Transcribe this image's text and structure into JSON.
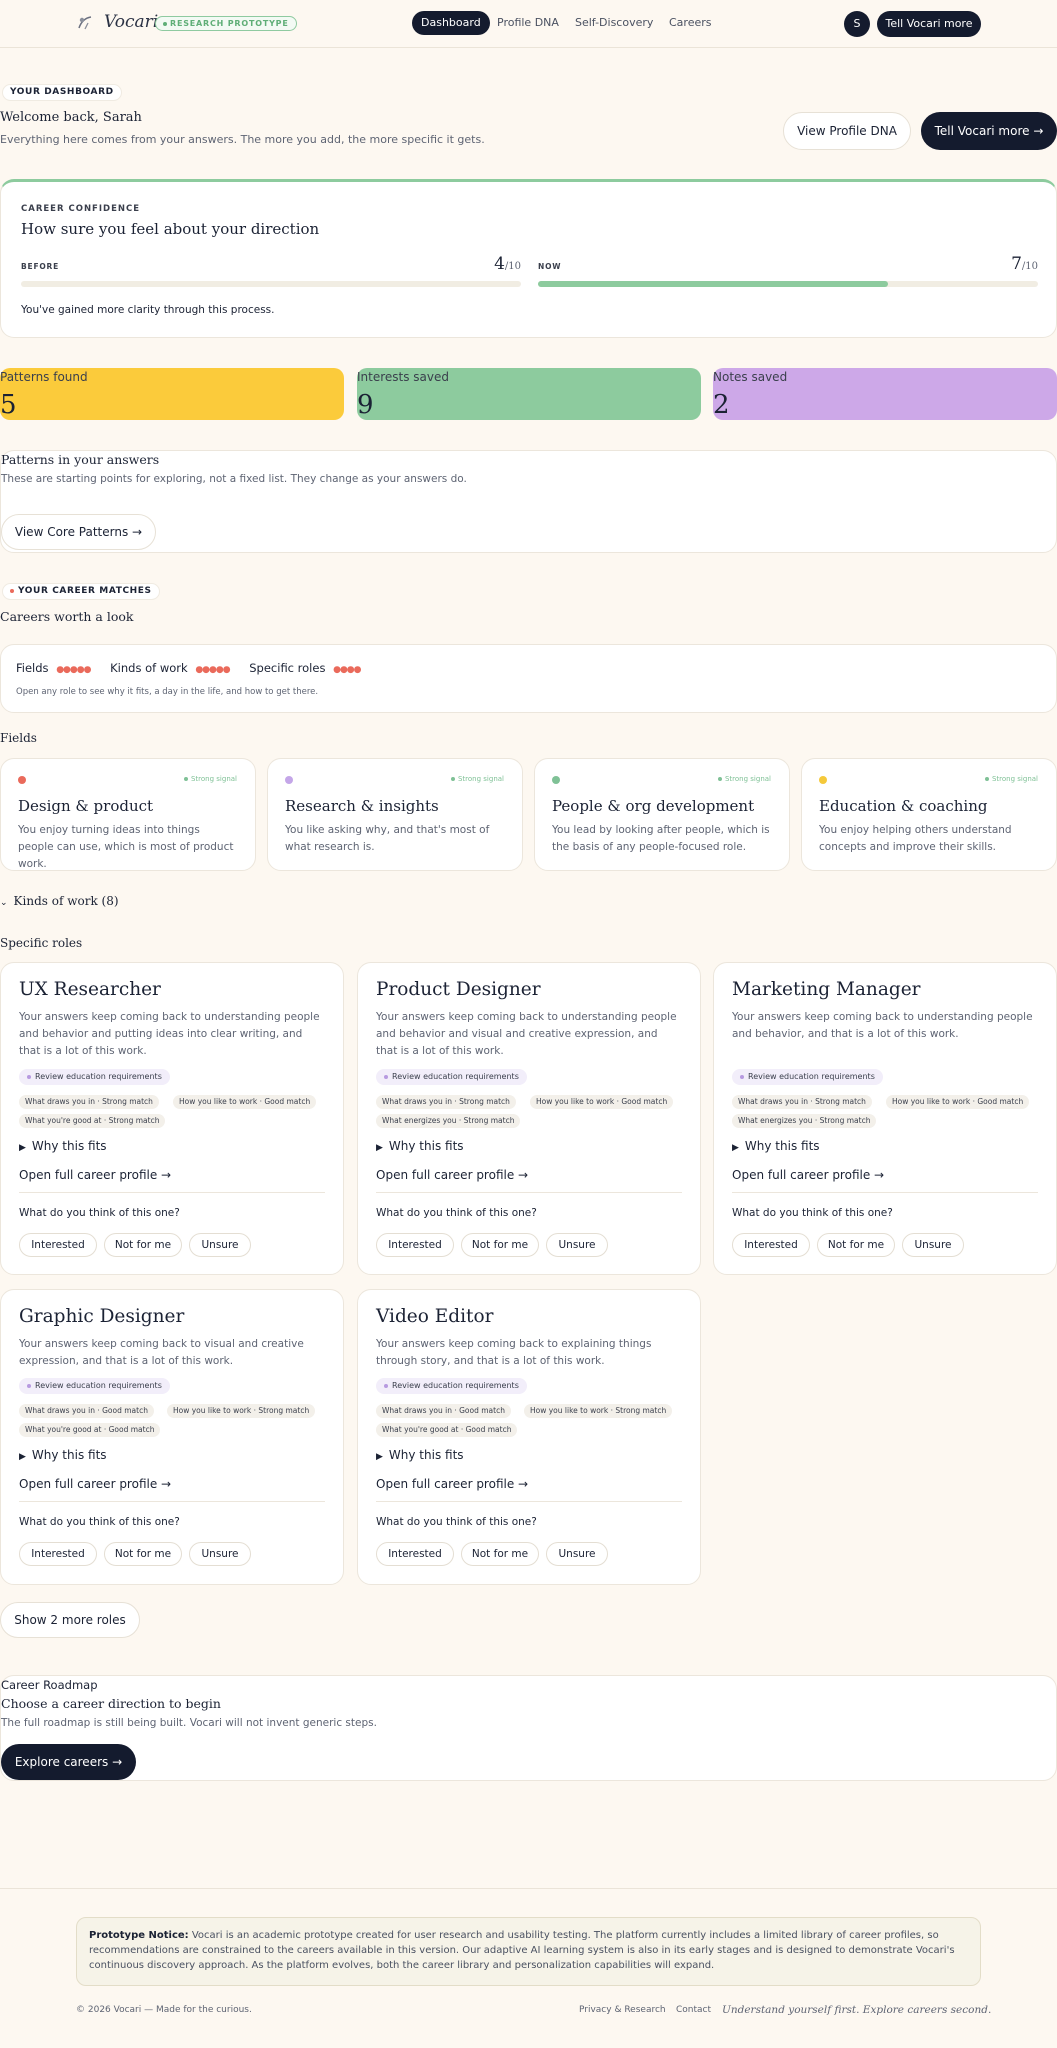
{
  "nav": {
    "brand": "Vocari",
    "badge": "RESEARCH PROTOTYPE",
    "links": [
      "Dashboard",
      "Profile DNA",
      "Self-Discovery",
      "Careers"
    ],
    "avatar_initial": "S",
    "cta": "Tell Vocari more"
  },
  "hero": {
    "eyebrow": "YOUR DASHBOARD",
    "greeting": "Welcome back, Sarah",
    "subtitle": "Everything here comes from your answers. The more you add, the more specific it gets.",
    "btn_profile": "View Profile DNA",
    "btn_tell": "Tell Vocari more →"
  },
  "confidence": {
    "eyebrow": "CAREER CONFIDENCE",
    "title": "How sure you feel about your direction",
    "before_label": "BEFORE",
    "before_value": "4",
    "before_fraction": 0,
    "now_label": "NOW",
    "now_value": "7",
    "now_fraction": 0.7,
    "denom": "/10",
    "message": "You've gained more clarity through this process."
  },
  "stats": [
    {
      "label": "Patterns found",
      "value": "5",
      "color": "#fbcb3b"
    },
    {
      "label": "Interests saved",
      "value": "9",
      "color": "#8dcb9e"
    },
    {
      "label": "Notes saved",
      "value": "2",
      "color": "#cda8e8"
    }
  ],
  "patterns": {
    "title": "Patterns in your answers",
    "subtitle": "These are starting points for exploring, not a fixed list. They change as your answers do.",
    "button": "View Core Patterns →"
  },
  "matches": {
    "eyebrow": "YOUR CAREER MATCHES",
    "title": "Careers worth a look",
    "legend": {
      "fields": "Fields",
      "fields_dots": "●●●●●",
      "kinds": "Kinds of work",
      "kinds_dots": "●●●●●",
      "roles": "Specific roles",
      "roles_dots": "●●●●"
    },
    "hint": "Open any role to see why it fits, a day in the life, and how to get there."
  },
  "fields": {
    "heading": "Fields",
    "items": [
      {
        "title": "Design & product",
        "signal": "Strong signal",
        "desc": "You enjoy turning ideas into things people can use, which is most of product work.",
        "color": "#ea6a5b"
      },
      {
        "title": "Research & insights",
        "signal": "Strong signal",
        "desc": "You like asking why, and that's most of what research is.",
        "color": "#c4a6e8"
      },
      {
        "title": "People & org development",
        "signal": "Strong signal",
        "desc": "You lead by looking after people, which is the basis of any people-focused role.",
        "color": "#7fc196"
      },
      {
        "title": "Education & coaching",
        "signal": "Strong signal",
        "desc": "You enjoy helping others understand concepts and improve their skills.",
        "color": "#f5c93a"
      }
    ]
  },
  "kinds": {
    "label": "Kinds of work",
    "count": "(8)"
  },
  "roles": {
    "heading": "Specific roles",
    "edu": "Review education requirements",
    "why": "Why this fits",
    "open": "Open full career profile →",
    "think": "What do you think of this one?",
    "options": [
      "Interested",
      "Not for me",
      "Unsure"
    ],
    "items": [
      {
        "title": "UX Researcher",
        "desc": "Your answers keep coming back to understanding people and behavior and putting ideas into clear writing, and that is a lot of this work.",
        "tags": [
          "What draws you in · Strong match",
          "How you like to work · Good match",
          "What you're good at · Strong match"
        ]
      },
      {
        "title": "Product Designer",
        "desc": "Your answers keep coming back to understanding people and behavior and visual and creative expression, and that is a lot of this work.",
        "tags": [
          "What draws you in · Strong match",
          "How you like to work · Good match",
          "What energizes you · Strong match"
        ]
      },
      {
        "title": "Marketing Manager",
        "desc": "Your answers keep coming back to understanding people and behavior, and that is a lot of this work.",
        "tags": [
          "What draws you in · Strong match",
          "How you like to work · Good match",
          "What energizes you · Strong match"
        ]
      },
      {
        "title": "Graphic Designer",
        "desc": "Your answers keep coming back to visual and creative expression, and that is a lot of this work.",
        "tags": [
          "What draws you in · Good match",
          "How you like to work · Strong match",
          "What you're good at · Good match"
        ]
      },
      {
        "title": "Video Editor",
        "desc": "Your answers keep coming back to explaining things through story, and that is a lot of this work.",
        "tags": [
          "What draws you in · Good match",
          "How you like to work · Strong match",
          "What you're good at · Good match"
        ]
      }
    ],
    "show_more": "Show 2 more roles"
  },
  "roadmap": {
    "eyebrow": "Career Roadmap",
    "title": "Choose a career direction to begin",
    "subtitle": "The full roadmap is still being built. Vocari will not invent generic steps.",
    "button": "Explore careers →"
  },
  "footer": {
    "notice_bold": "Prototype Notice:",
    "notice": "Vocari is an academic prototype created for user research and usability testing. The platform currently includes a limited library of career profiles, so recommendations are constrained to the careers available in this version. Our adaptive AI learning system is also in its early stages and is designed to demonstrate Vocari's continuous discovery approach. As the platform evolves, both the career library and personalization capabilities will expand.",
    "copyright": "© 2026 Vocari — Made for the curious.",
    "privacy": "Privacy & Research",
    "contact": "Contact",
    "tagline": "Understand yourself first. Explore careers second."
  }
}
